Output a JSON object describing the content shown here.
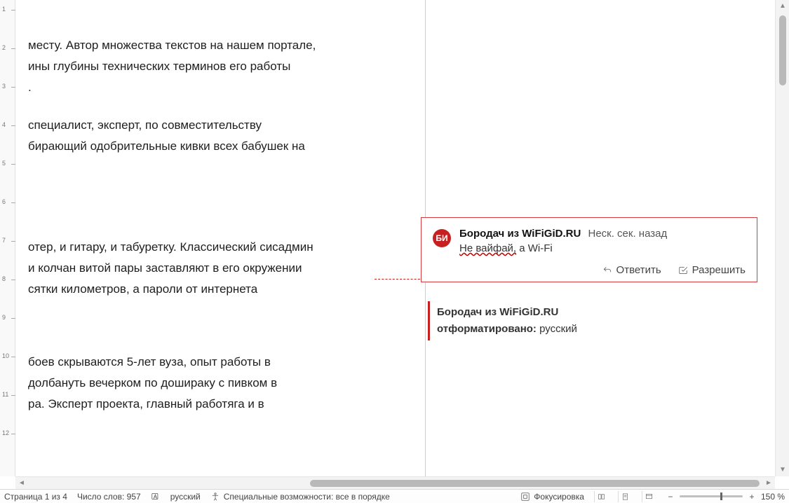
{
  "ruler": {
    "labels": [
      "1",
      "2",
      "3",
      "4",
      "5",
      "6",
      "7",
      "8",
      "9",
      "10",
      "11",
      "12"
    ]
  },
  "doc": {
    "p1": "месту. Автор множества текстов на нашем портале,\nины глубины технических терминов его работы\n.",
    "p2": "специалист, эксперт, по совместительству\nбирающий одобрительные кивки всех бабушек на",
    "p3": "отер, и гитару, и табуретку. Классический сисадмин\nи колчан витой пары заставляют в его окружении\nсятки километров, а пароли от интернета",
    "p4": "боев скрываются 5-лет вуза, опыт работы в\nдолбануть вечерком по дошираку с пивком в\nра. Эксперт проекта, главный работяга и в"
  },
  "comment": {
    "initials": "БИ",
    "author": "Бородач из WiFiGiD.RU",
    "time": "Неск. сек. назад",
    "text_underlined": "Не вайфай,",
    "text_rest": " а Wi-Fi",
    "actions": {
      "reply": "Ответить",
      "resolve": "Разрешить"
    }
  },
  "tracked": {
    "author": "Бородач из WiFiGiD.RU",
    "label": "отформатировано:",
    "value": " русский"
  },
  "status": {
    "page": "Страница 1 из 4",
    "words": "Число слов: 957",
    "lang": "русский",
    "a11y": "Специальные возможности: все в порядке",
    "focus": "Фокусировка",
    "zoom": "150 %"
  }
}
